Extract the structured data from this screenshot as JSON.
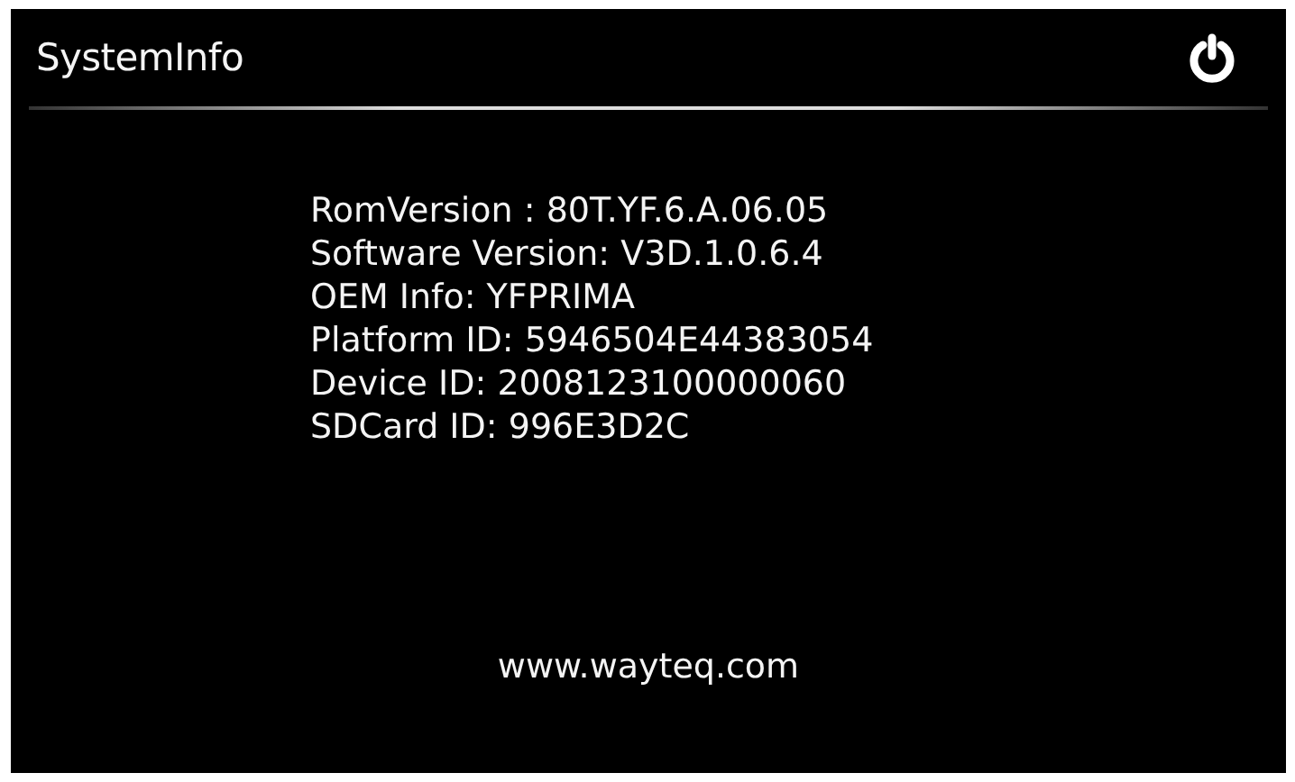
{
  "window": {
    "title": "SystemInfo"
  },
  "info_lines": [
    "RomVersion : 80T.YF.6.A.06.05",
    "Software Version: V3D.1.0.6.4",
    "OEM Info: YFPRIMA",
    "Platform ID: 5946504E44383054",
    "Device ID: 2008123100000060",
    "SDCard ID: 996E3D2C"
  ],
  "footer": "www.wayteq.com"
}
